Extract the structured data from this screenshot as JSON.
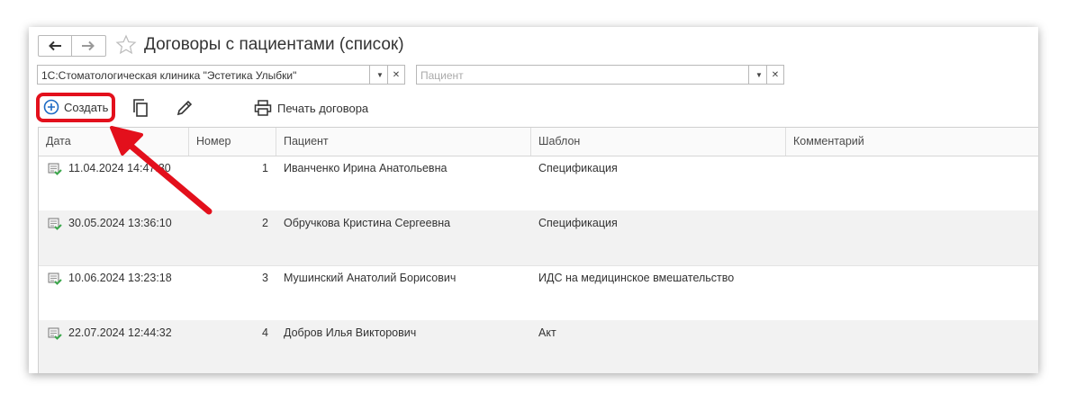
{
  "window": {
    "title": "Договоры с пациентами (список)"
  },
  "filters": {
    "organization_value": "1С:Стоматологическая клиника \"Эстетика Улыбки\"",
    "patient_placeholder": "Пациент"
  },
  "toolbar": {
    "create_label": "Создать",
    "print_label": "Печать договора"
  },
  "table": {
    "columns": [
      "Дата",
      "Номер",
      "Пациент",
      "Шаблон",
      "Комментарий"
    ],
    "rows": [
      {
        "date": "11.04.2024 14:47:30",
        "number": "1",
        "patient": "Иванченко Ирина Анатольевна",
        "template": "Спецификация",
        "comment": ""
      },
      {
        "date": "30.05.2024 13:36:10",
        "number": "2",
        "patient": "Обручкова Кристина Сергеевна",
        "template": "Спецификация",
        "comment": ""
      },
      {
        "date": "10.06.2024 13:23:18",
        "number": "3",
        "patient": "Мушинский Анатолий Борисович",
        "template": "ИДС на медицинское вмешательство",
        "comment": ""
      },
      {
        "date": "22.07.2024 12:44:32",
        "number": "4",
        "patient": "Добров Илья Викторович",
        "template": "Акт",
        "comment": ""
      }
    ]
  },
  "colors": {
    "highlight": "#e3101c",
    "accent_blue": "#1e6bc4",
    "doc_icon_green": "#3aa64a"
  },
  "icons": [
    "back-arrow-icon",
    "forward-arrow-icon",
    "star-icon",
    "plus-circle-icon",
    "copy-icon",
    "pencil-icon",
    "printer-icon",
    "document-icon",
    "dropdown-icon",
    "clear-icon"
  ]
}
